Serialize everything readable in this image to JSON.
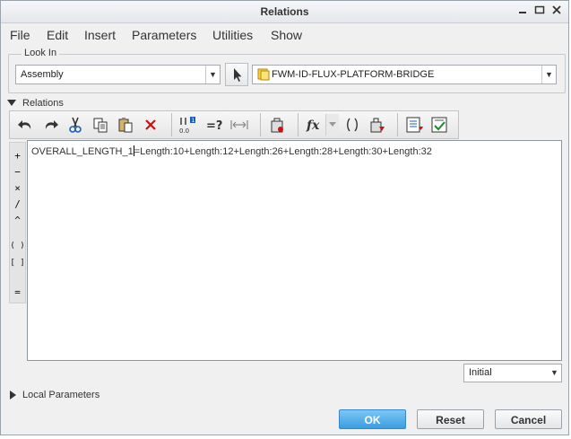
{
  "window": {
    "title": "Relations"
  },
  "window_controls": [
    "minimize-icon",
    "maximize-icon",
    "close-icon"
  ],
  "menu": [
    "File",
    "Edit",
    "Insert",
    "Parameters",
    "Utilities",
    "Show"
  ],
  "look_in": {
    "label": "Look In",
    "type_value": "Assembly",
    "model_value": "FWM-ID-FLUX-PLATFORM-BRIDGE"
  },
  "relations_section": {
    "label": "Relations"
  },
  "toolbar_icons": [
    "undo-icon",
    "redo-icon",
    "cut-icon",
    "copy-icon",
    "paste-icon",
    "delete-icon",
    "units-icon",
    "evaluate-icon",
    "measure-icon",
    "verify-icon",
    "function-icon",
    "bracket-icon",
    "sort-icon",
    "preview-icon",
    "check-icon"
  ],
  "operators": [
    "+",
    "−",
    "×",
    "/",
    "^",
    "( )",
    "[ ]",
    "="
  ],
  "editor": {
    "before_caret": "OVERALL_LENGTH_1",
    "after_caret": "=Length:10+Length:12+Length:26+Length:28+Length:30+Length:32"
  },
  "status_select": {
    "value": "Initial"
  },
  "local_parameters": {
    "label": "Local Parameters"
  },
  "buttons": {
    "ok": "OK",
    "reset": "Reset",
    "cancel": "Cancel"
  },
  "colors": {
    "primary_button": "#3b9ee0",
    "delete_icon": "#cc1111",
    "model_icon": "#e8b400"
  }
}
